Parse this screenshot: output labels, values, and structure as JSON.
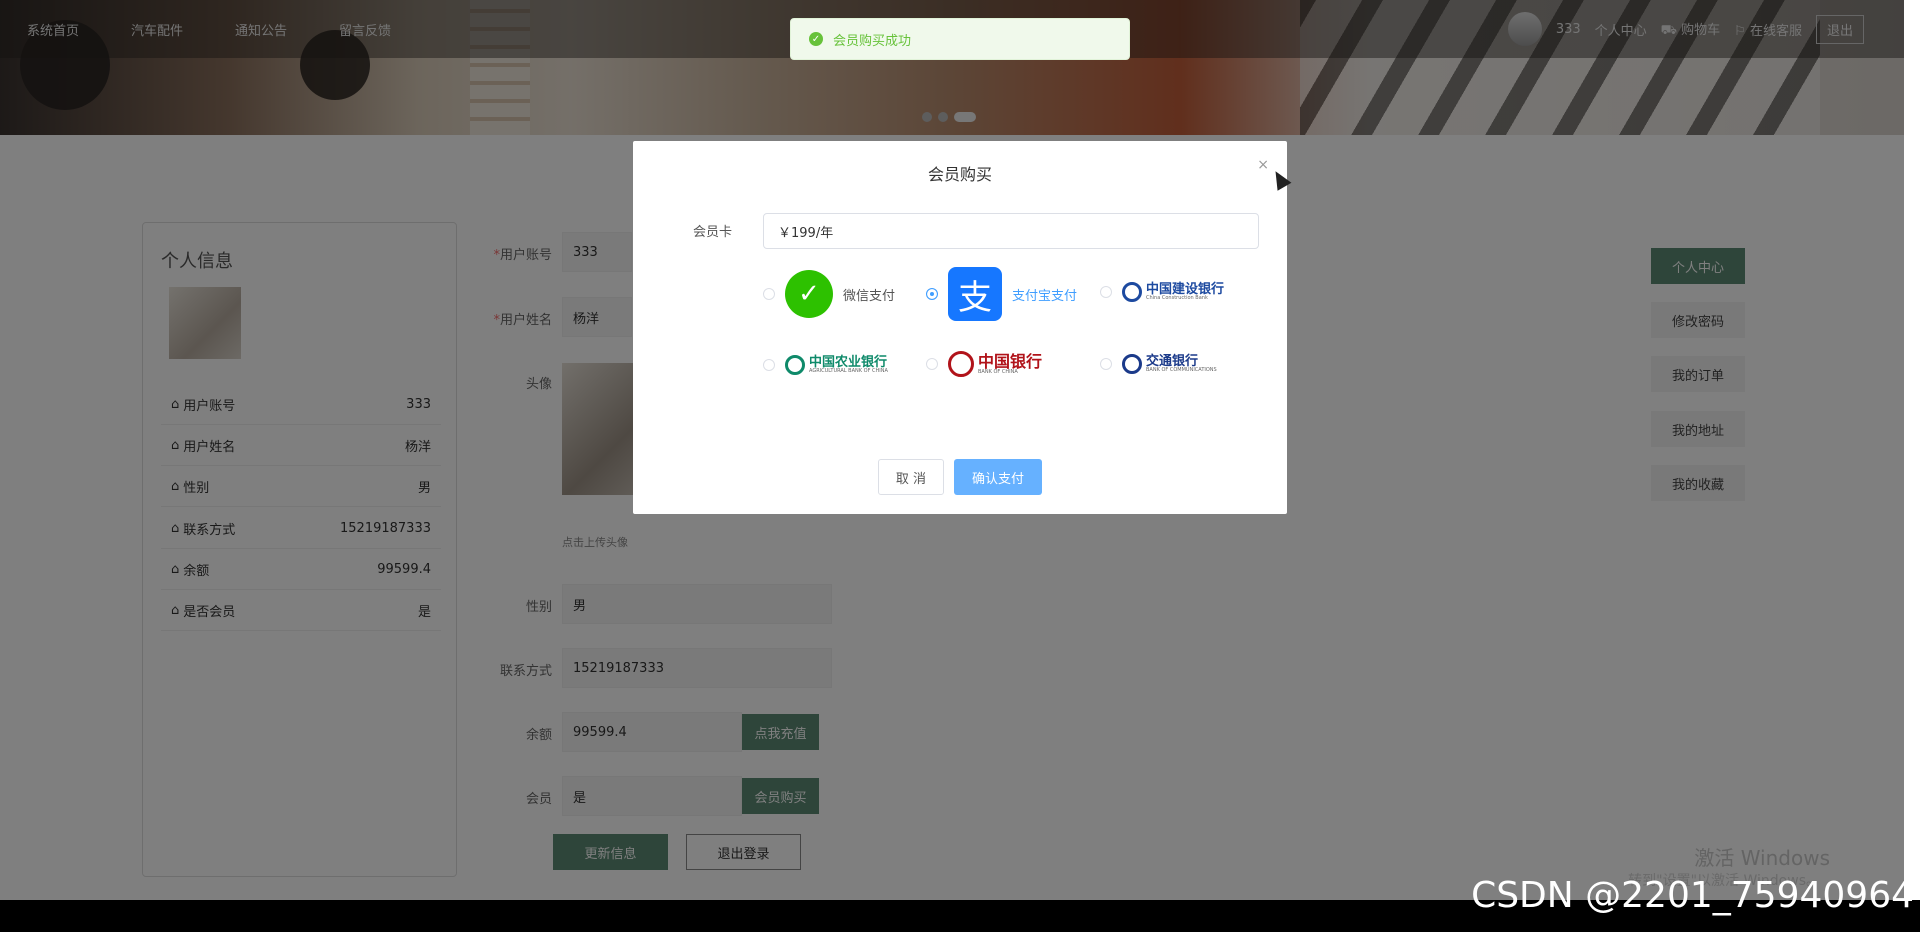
{
  "nav": {
    "items": [
      "系统首页",
      "汽车配件",
      "通知公告",
      "留言反馈"
    ],
    "username": "333",
    "personal_center": "个人中心",
    "cart": "购物车",
    "service": "在线客服",
    "logout": "退出"
  },
  "toast": {
    "message": "会员购买成功"
  },
  "profile_panel": {
    "title": "个人信息",
    "rows": [
      {
        "label": "用户账号",
        "value": "333"
      },
      {
        "label": "用户姓名",
        "value": "杨洋"
      },
      {
        "label": "性别",
        "value": "男"
      },
      {
        "label": "联系方式",
        "value": "15219187333"
      },
      {
        "label": "余额",
        "value": "99599.4"
      },
      {
        "label": "是否会员",
        "value": "是"
      }
    ]
  },
  "form": {
    "account_label": "用户账号",
    "account_value": "333",
    "name_label": "用户姓名",
    "name_value": "杨洋",
    "avatar_label": "头像",
    "upload_hint": "点击上传头像",
    "gender_label": "性别",
    "gender_value": "男",
    "phone_label": "联系方式",
    "phone_value": "15219187333",
    "balance_label": "余额",
    "balance_value": "99599.4",
    "recharge_btn": "点我充值",
    "member_label": "会员",
    "member_value": "是",
    "member_buy_btn": "会员购买",
    "update_btn": "更新信息",
    "logout_btn": "退出登录",
    "required_mark": "*"
  },
  "side_menu": [
    "个人中心",
    "修改密码",
    "我的订单",
    "我的地址",
    "我的收藏"
  ],
  "modal": {
    "title": "会员购买",
    "close": "×",
    "card_label": "会员卡",
    "card_value": "￥199/年",
    "payments": [
      {
        "name": "微信支付",
        "selected": false
      },
      {
        "name": "支付宝支付",
        "selected": true
      }
    ],
    "banks": [
      {
        "cn": "中国建设银行",
        "en": "China Construction Bank",
        "color": "#1d4aa0"
      },
      {
        "cn": "中国农业银行",
        "en": "AGRICULTURAL BANK OF CHINA",
        "color": "#0f8a6a"
      },
      {
        "cn": "中国银行",
        "en": "BANK OF CHINA",
        "color": "#b1131a"
      },
      {
        "cn": "交通银行",
        "en": "BANK OF COMMUNICATIONS",
        "color": "#1b3a8a"
      }
    ],
    "cancel": "取 消",
    "confirm": "确认支付"
  },
  "watermark": {
    "line1": "激活 Windows",
    "line2": "转到\"设置\"以激活 Windows。"
  },
  "footer_mark": "CSDN @2201_75940964",
  "colors": {
    "accent_green": "#5c8a74",
    "primary_blue": "#409eff",
    "success_green": "#67c23a"
  }
}
